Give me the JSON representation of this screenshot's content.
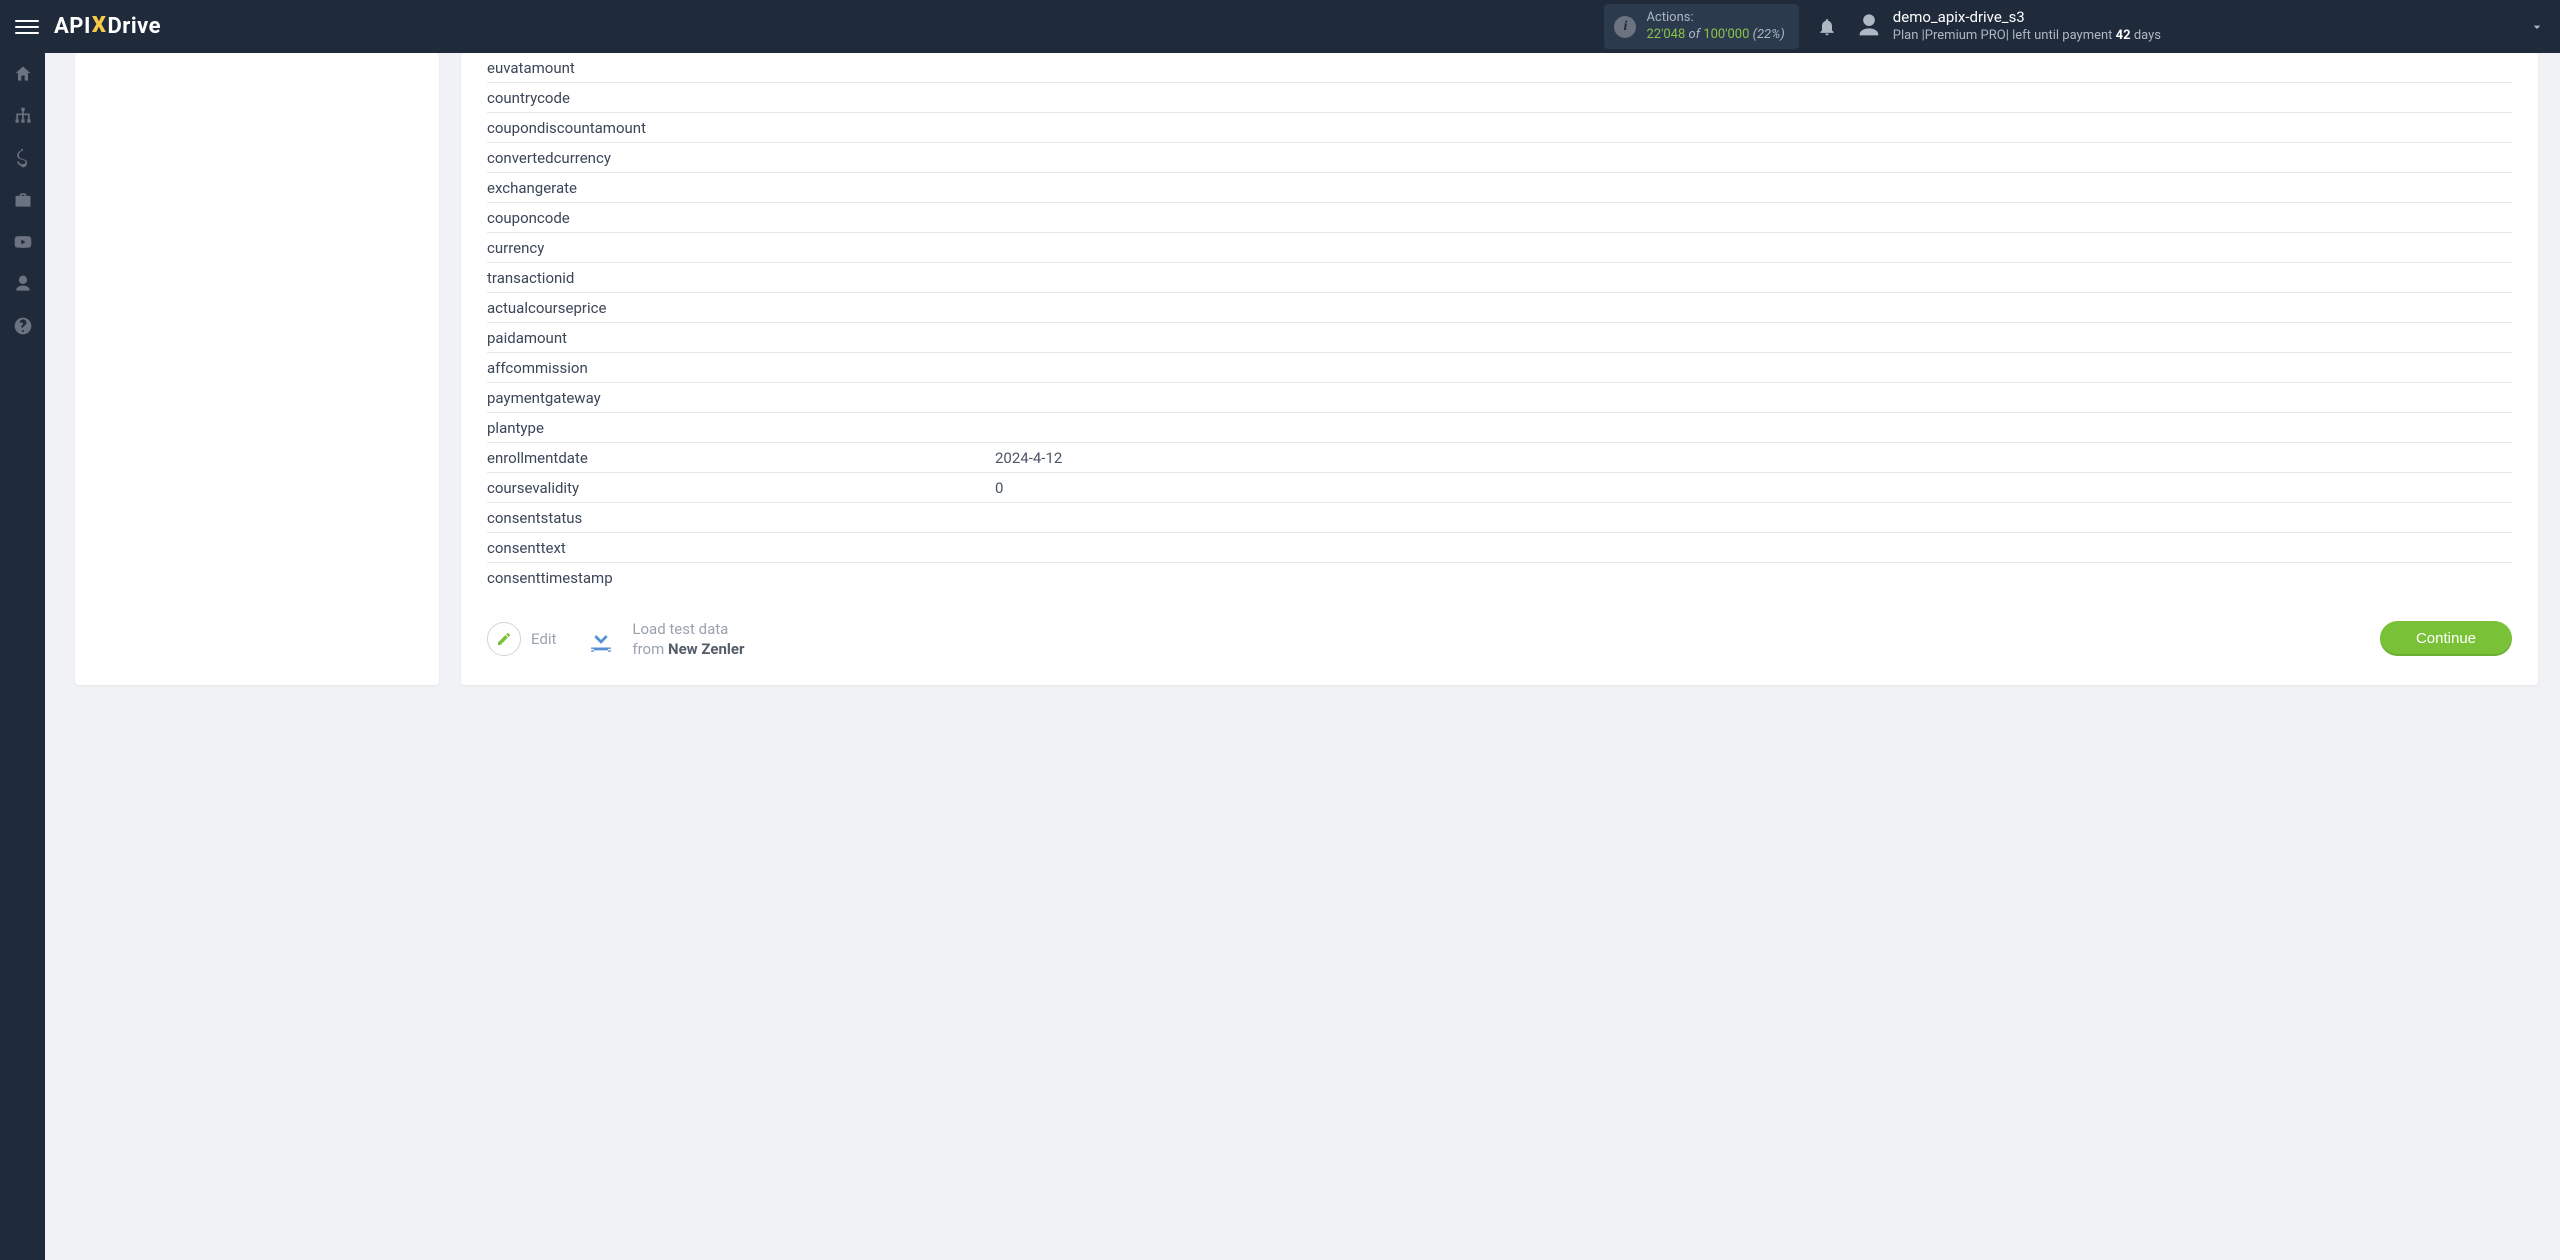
{
  "header": {
    "logo": {
      "part1": "API",
      "part2": "X",
      "part3": "Drive"
    },
    "actions": {
      "label": "Actions:",
      "current": "22'048",
      "of_word": "of",
      "total": "100'000",
      "pct": "(22%)"
    },
    "user": {
      "name": "demo_apix-drive_s3",
      "plan_prefix": "Plan |",
      "plan_name": "Premium PRO",
      "plan_mid": "| left until payment ",
      "days_num": "42",
      "days_word": " days"
    }
  },
  "rows": [
    {
      "key": "euvatamount",
      "val": ""
    },
    {
      "key": "countrycode",
      "val": ""
    },
    {
      "key": "coupondiscountamount",
      "val": ""
    },
    {
      "key": "convertedcurrency",
      "val": ""
    },
    {
      "key": "exchangerate",
      "val": ""
    },
    {
      "key": "couponcode",
      "val": ""
    },
    {
      "key": "currency",
      "val": ""
    },
    {
      "key": "transactionid",
      "val": ""
    },
    {
      "key": "actualcourseprice",
      "val": ""
    },
    {
      "key": "paidamount",
      "val": ""
    },
    {
      "key": "affcommission",
      "val": ""
    },
    {
      "key": "paymentgateway",
      "val": ""
    },
    {
      "key": "plantype",
      "val": ""
    },
    {
      "key": "enrollmentdate",
      "val": "2024-4-12"
    },
    {
      "key": "coursevalidity",
      "val": "0"
    },
    {
      "key": "consentstatus",
      "val": ""
    },
    {
      "key": "consenttext",
      "val": ""
    },
    {
      "key": "consenttimestamp",
      "val": ""
    }
  ],
  "footer": {
    "edit_label": "Edit",
    "load_line1": "Load test data",
    "load_from": "from ",
    "load_source": "New Zenler",
    "continue_label": "Continue"
  }
}
